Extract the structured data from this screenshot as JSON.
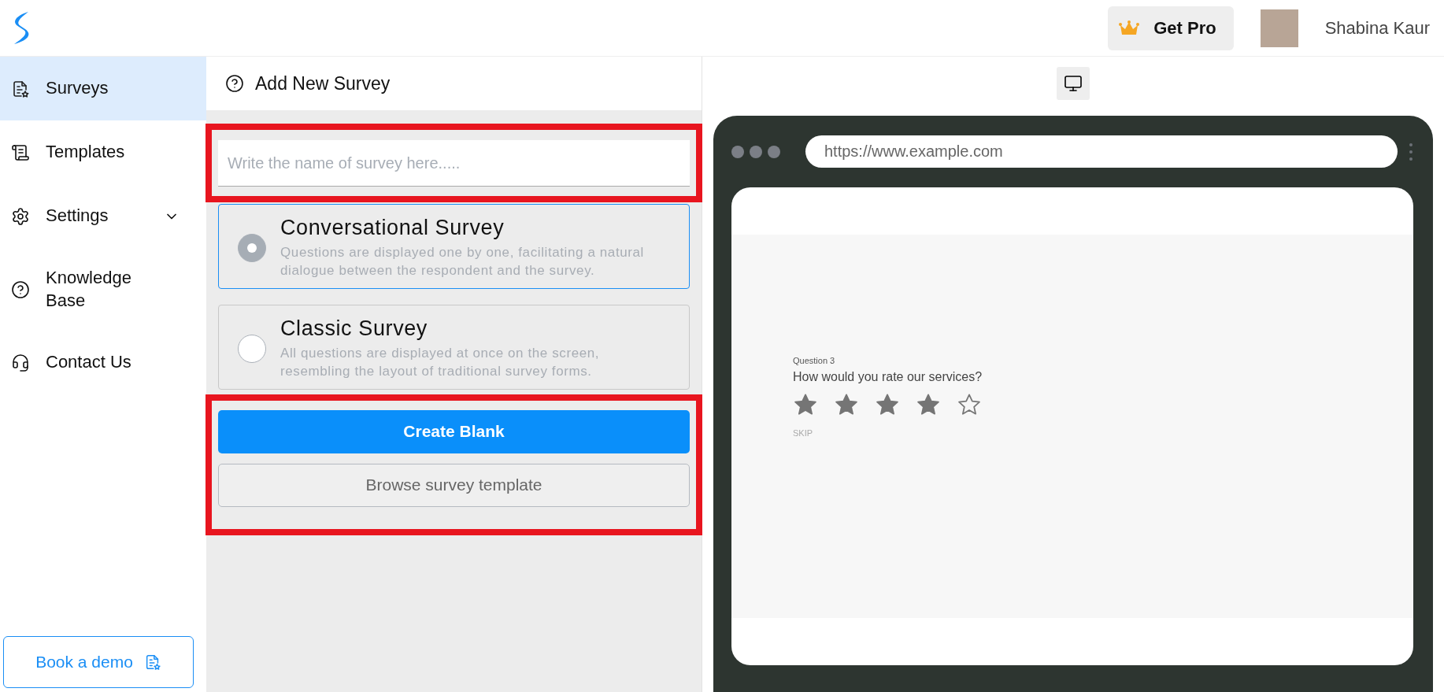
{
  "header": {
    "upgrade_button": "Get Pro",
    "user_name": "Shabina Kaur"
  },
  "sidebar": {
    "items": [
      {
        "label": "Surveys",
        "selected": true
      },
      {
        "label": "Templates",
        "selected": false
      },
      {
        "label": "Settings",
        "selected": false,
        "expanded": false
      },
      {
        "label": "Knowledge Base",
        "selected": false
      },
      {
        "label": "Contact Us",
        "selected": false
      }
    ],
    "book_demo": "Book a demo"
  },
  "panel": {
    "title": "Add New Survey",
    "name_field": {
      "placeholder": "Write the name of survey here.....",
      "highlighted": true
    },
    "survey_types": [
      {
        "title": "Conversational Survey",
        "description": "Questions are displayed one by one, facilitating a natural dialogue between the respondent and the survey.",
        "selected": true
      },
      {
        "title": "Classic Survey",
        "description": "All questions are displayed at once on the screen, resembling the layout of traditional survey forms.",
        "selected": false
      }
    ],
    "actions": {
      "highlighted": true,
      "buttons": [
        {
          "label": "Create Blank",
          "kind": "primary"
        },
        {
          "label": "Browse survey template",
          "kind": "secondary"
        }
      ]
    }
  },
  "preview": {
    "url": "https://www.example.com",
    "question_number": "Question 3",
    "question": "How would you rate our services?",
    "stars": 4,
    "skip": "SKIP"
  }
}
